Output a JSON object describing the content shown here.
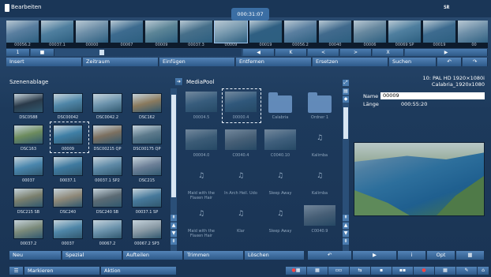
{
  "window": {
    "title": "Bearbeiten",
    "logo_text": "SR"
  },
  "timeline": {
    "timecode": "000:31:07",
    "frames": [
      {
        "label": "00056.2",
        "color": "#5a7fa0"
      },
      {
        "label": "00037.1",
        "color": "#4f7f9f"
      },
      {
        "label": "00000",
        "color": "#6e8fa8"
      },
      {
        "label": "00067",
        "color": "#3d6b8f"
      },
      {
        "label": "00009",
        "color": "#5c8597"
      },
      {
        "label": "00037.3",
        "color": "#466f8a"
      },
      {
        "label": "00009",
        "color": "#7a9bb0"
      },
      {
        "label": "00019",
        "color": "#2f5f82"
      },
      {
        "label": "00056.2",
        "color": "#5a7fa0"
      },
      {
        "label": "00040",
        "color": "#416a8d"
      },
      {
        "label": "00006",
        "color": "#67889f"
      },
      {
        "label": "00069 SP",
        "color": "#4f7f9f"
      },
      {
        "label": "00019",
        "color": "#3d6b8f"
      },
      {
        "label": "00",
        "color": "#6e8fa8"
      }
    ]
  },
  "nav": {
    "page": "1",
    "skip_back": "◀",
    "prev_cut": "K",
    "prev": "<",
    "next": ">",
    "next_cut": "X",
    "play": "▶"
  },
  "toolbar": {
    "insert": "Insert",
    "zeitraum": "Zeitraum",
    "einfuegen": "Einfügen",
    "entfernen": "Entfernen",
    "ersetzen": "Ersetzen",
    "suchen": "Suchen",
    "undo": "↶",
    "redo": "↷"
  },
  "scenes": {
    "title": "Szenenablage",
    "items": [
      {
        "label": "DSC0588",
        "color": "#2a3a4a"
      },
      {
        "label": "DSC00042",
        "color": "#4f86a8"
      },
      {
        "label": "DSC0042.2",
        "color": "#6d94ad"
      },
      {
        "label": "DSC162",
        "color": "#8a7a5e"
      },
      {
        "label": "DSC163",
        "color": "#6d8c5e"
      },
      {
        "label": "00009",
        "color": "#3f7fa6"
      },
      {
        "label": "DSC00215 QP",
        "color": "#7c7060"
      },
      {
        "label": "DSC00175 QP",
        "color": "#5d7a8c"
      },
      {
        "label": "00037",
        "color": "#4a86ad"
      },
      {
        "label": "00037.1",
        "color": "#3f7aa0"
      },
      {
        "label": "00037.1 SP2",
        "color": "#5f8aa7"
      },
      {
        "label": "DSC215",
        "color": "#6d8098"
      },
      {
        "label": "DSC215 SB",
        "color": "#7a7f6d"
      },
      {
        "label": "DSC240",
        "color": "#8e8878"
      },
      {
        "label": "DSC240 SB",
        "color": "#5c6b74"
      },
      {
        "label": "00037.1 SP",
        "color": "#47799b"
      },
      {
        "label": "00037.2",
        "color": "#7b8a7a"
      },
      {
        "label": "00037",
        "color": "#4f86a8"
      },
      {
        "label": "00067.2",
        "color": "#6d94ad"
      },
      {
        "label": "00067.2 SP3",
        "color": "#8a9aa5"
      }
    ]
  },
  "mediapool": {
    "title": "MediaPool",
    "items": [
      {
        "label": "00004.5",
        "kind": "thumb",
        "color": "#4d7896"
      },
      {
        "label": "00000.4",
        "kind": "thumb",
        "color": "#3f6f93"
      },
      {
        "label": "Calabria",
        "kind": "folder"
      },
      {
        "label": "Ordner 1",
        "kind": "folder"
      },
      {
        "label": "00004.0",
        "kind": "thumb",
        "color": "#55788d"
      },
      {
        "label": "C0040.4",
        "kind": "thumb",
        "color": "#6a7f8d"
      },
      {
        "label": "C0040.10",
        "kind": "thumb",
        "color": "#5d7f98"
      },
      {
        "label": "Kalimba",
        "kind": "audio"
      },
      {
        "label": "Maid with the Flaxen Hair",
        "kind": "audio"
      },
      {
        "label": "In Arch Heil. Udo",
        "kind": "audio"
      },
      {
        "label": "Sleep Away",
        "kind": "audio"
      },
      {
        "label": "Kalimba",
        "kind": "audio"
      },
      {
        "label": "Maid with the Flaxen Hair",
        "kind": "audio"
      },
      {
        "label": "Klar",
        "kind": "audio"
      },
      {
        "label": "Sleep Away",
        "kind": "audio"
      },
      {
        "label": "C0040.9",
        "kind": "thumb",
        "color": "#6b8090"
      }
    ]
  },
  "info": {
    "format": "10: PAL HD 1920×1080i",
    "project": "Calabria_1920x1080",
    "name_label": "Name",
    "name_value": "00009",
    "length_label": "Länge",
    "length_value": "000:55:20"
  },
  "bottom": {
    "neu": "Neu",
    "spezial": "Spezial",
    "aufteilen": "Aufteilen",
    "trimmen": "Trimmen",
    "loeschen": "Löschen",
    "undo": "↶",
    "play": "▶",
    "info": "i",
    "opt": "Opt",
    "calc": "▦"
  },
  "status": {
    "markieren": "Markieren",
    "aktion": "Aktion"
  }
}
